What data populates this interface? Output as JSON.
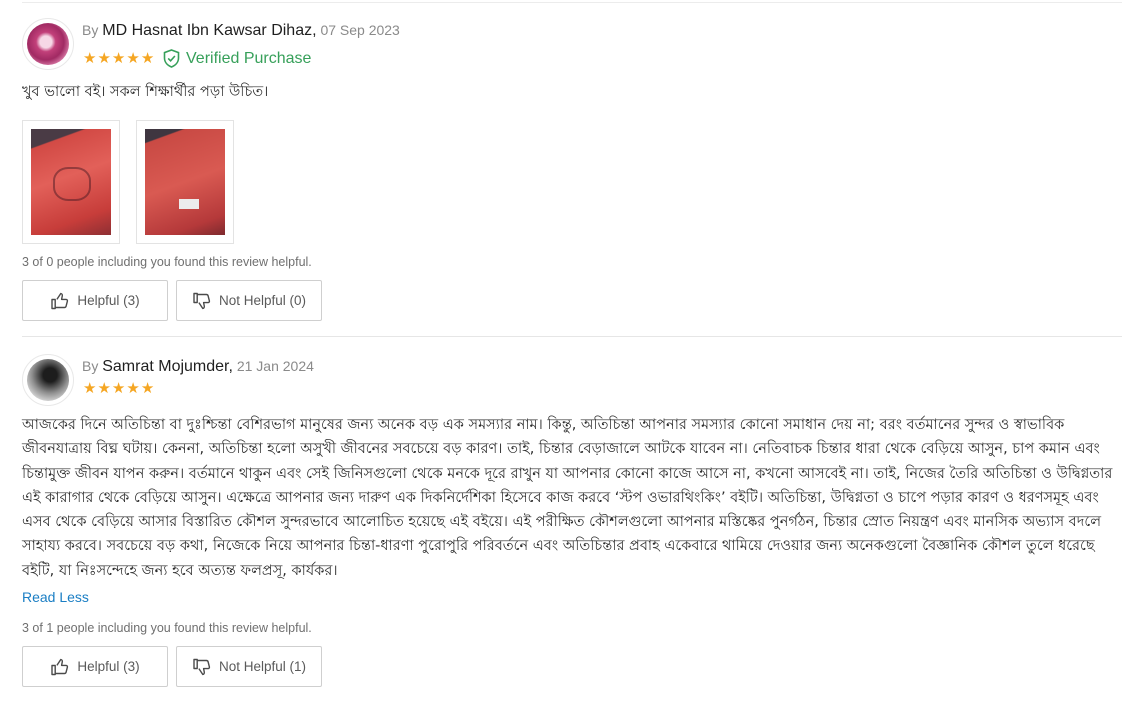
{
  "reviews": [
    {
      "by_prefix": "By",
      "author": "MD Hasnat Ibn Kawsar Dihaz,",
      "date": "07 Sep 2023",
      "rating": 5,
      "verified_label": "Verified Purchase",
      "text": "খুব ভালো বই। সকল শিক্ষার্থীর পড়া উচিত।",
      "photos": [
        "book-cover-photo",
        "book-back-photo"
      ],
      "helpful_note": "3 of 0 people including you found this review helpful.",
      "helpful_label": "Helpful (3)",
      "not_helpful_label": "Not Helpful (0)"
    },
    {
      "by_prefix": "By",
      "author": "Samrat Mojumder,",
      "date": "21 Jan 2024",
      "rating": 5,
      "text": "আজকের দিনে অতিচিন্তা বা দুঃশ্চিন্তা বেশিরভাগ মানুষের জন্য অনেক বড় এক সমস্যার নাম। কিন্তু, অতিচিন্তা আপনার সমস্যার কোনো সমাধান দেয় না; বরং বর্তমানের সুন্দর ও স্বাভাবিক জীবনযাত্রায় বিঘ্ন ঘটায়। কেননা, অতিচিন্তা হলো অসুখী জীবনের সবচেয়ে বড় কারণ। তাই, চিন্তার বেড়াজালে আটকে যাবেন না। নেতিবাচক চিন্তার ধারা থেকে বেড়িয়ে আসুন, চাপ কমান এবং চিন্তামুক্ত জীবন যাপন করুন। বর্তমানে থাকুন এবং সেই জিনিসগুলো থেকে মনকে দূরে রাখুন যা আপনার কোনো কাজে আসে না, কখনো আসবেই না। তাই, নিজের তৈরি অতিচিন্তা ও উদ্বিগ্নতার এই কারাগার থেকে বেড়িয়ে আসুন। এক্ষেত্রে আপনার জন্য দারুণ এক দিকনির্দেশিকা হিসেবে কাজ করবে ‘স্টপ ওভারথিংকিং’ বইটি। অতিচিন্তা, উদ্বিগ্নতা ও চাপে পড়ার কারণ ও ধরণসমূহ এবং এসব থেকে বেড়িয়ে আসার বিস্তারিত কৌশল সুন্দরভাবে আলোচিত হয়েছে এই বইয়ে। এই পরীক্ষিত কৌশলগুলো আপনার মস্তিষ্কের পুনর্গঠন, চিন্তার স্রোত নিয়ন্ত্রণ এবং মানসিক অভ্যাস বদলে সাহায্য করবে। সবচেয়ে বড় কথা, নিজেকে নিয়ে আপনার চিন্তা-ধারণা পুরোপুরি পরিবর্তনে এবং অতিচিন্তার প্রবাহ একেবারে থামিয়ে দেওয়ার জন্য অনেকগুলো বৈজ্ঞানিক কৌশল তুলে ধরেছে বইটি, যা নিঃসন্দেহে জন্য হবে অত্যন্ত ফলপ্রসূ, কার্যকর।",
      "read_less_label": "Read Less",
      "helpful_note": "3 of 1 people including you found this review helpful.",
      "helpful_label": "Helpful (3)",
      "not_helpful_label": "Not Helpful (1)"
    }
  ],
  "colors": {
    "star": "#f5a623",
    "verified": "#37a05a",
    "link": "#1a7ec4"
  }
}
